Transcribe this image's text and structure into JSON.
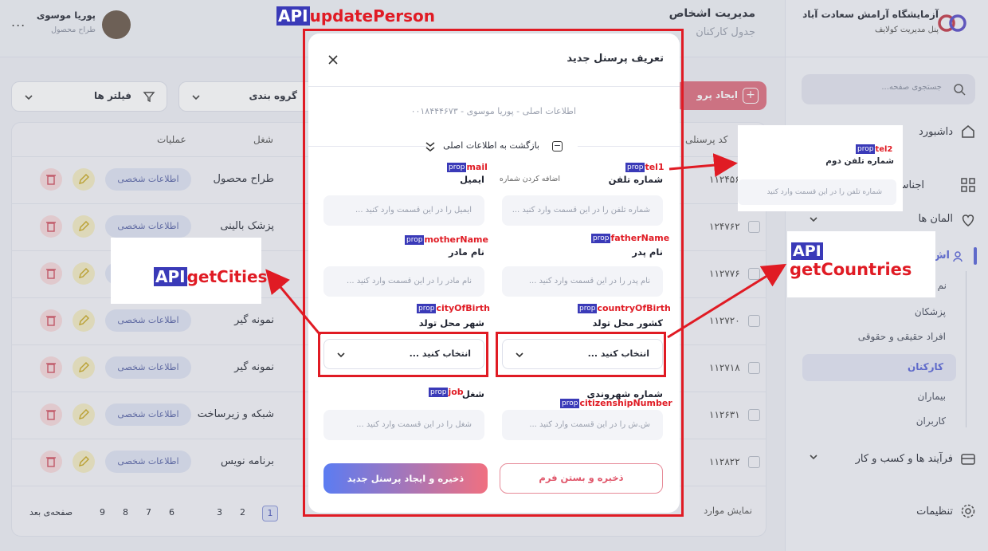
{
  "brand": {
    "title": "آزمایشگاه آرامش سعادت آباد",
    "subtitle": "پنل مدیریت کولایف"
  },
  "header": {
    "title": "مدیریت اشخاص",
    "subtitle": "جدول کارکنان"
  },
  "user": {
    "name": "پوریا موسوی",
    "role": "طراح محصول",
    "more": "..."
  },
  "search": {
    "placeholder": "جستجوی صفحه..."
  },
  "sidebar": {
    "dashboard": "داشبورد",
    "items_partial": [
      "اجناس فیزی",
      "المان ها",
      "اش"
    ],
    "subitems": [
      "پزشکان",
      "افراد حقیقی و حقوقی",
      "کارکنان",
      "بیماران",
      "کاربران"
    ],
    "sub_partial": "نم",
    "processes": "فرآیند ها و کسب و کار",
    "settings": "تنظیمات"
  },
  "toolbar": {
    "create_partial": "ایجاد پرو",
    "group": "گروه بندی",
    "filters": "فیلتر ها"
  },
  "table": {
    "headers": {
      "code": "کد پرسنلی",
      "job": "شغل",
      "ops": "عملیات"
    },
    "chip": "اطلاعات شخصی",
    "rows": [
      {
        "code": "۱۱۲۴۵۶",
        "job": "طراح محصول"
      },
      {
        "code": "۱۲۴۷۶۲",
        "job": "پزشک بالینی"
      },
      {
        "code": "۱۱۲۷۷۶",
        "job": ""
      },
      {
        "code": "۱۱۲۷۲۰",
        "job": "نمونه گیر"
      },
      {
        "code": "۱۱۲۷۱۸",
        "job": "نمونه گیر"
      },
      {
        "code": "۱۱۲۶۳۱",
        "job": "شبکه و زیرساخت"
      },
      {
        "code": "۱۱۲۸۲۲",
        "job": "برنامه نویس"
      }
    ]
  },
  "pagination": {
    "pages": [
      "1",
      "2",
      "3",
      "6",
      "7",
      "8",
      "9"
    ],
    "next": "صفحه‌ی بعد",
    "showing": "نمایش موارد"
  },
  "modal": {
    "title": "تعریف پرسنل جدید",
    "breadcrumb": "اطلاعات اصلی - پوریا موسوی - ۰۰۱۸۴۴۴۶۷۳",
    "back": "بازگشت به اطلاعات اصلی",
    "phone_label": "شماره تلفن",
    "phone_placeholder": "شماره تلفن را در این قسمت وارد کنید ...",
    "add_phone": "اضافه کردن شماره",
    "email_label": "ایمیل",
    "email_placeholder": "ایمیل را در این قسمت وارد کنید ...",
    "father_label": "نام پدر",
    "father_placeholder": "نام پدر را در این قسمت وارد کنید ...",
    "mother_label": "نام مادر",
    "mother_placeholder": "نام مادر را در این قسمت وارد کنید ...",
    "country_label": "کشور محل تولد",
    "city_label": "شهر محل تولد",
    "select_placeholder": "انتخاب کنید ...",
    "citizen_label": "شماره شهروندی",
    "citizen_placeholder": "ش.ش را در این قسمت وارد کنید ...",
    "job_label": "شغل",
    "job_placeholder": "شغل را در این قسمت وارد کنید ...",
    "save_close": "ذخیره و بستن فرم",
    "save_new": "ذخیره و ایجاد پرسنل جدید"
  },
  "annotations": {
    "api_tag": "API",
    "prop_tag": "prop",
    "update": "updatePerson",
    "cities": "getCities",
    "countries": "getCountries",
    "tel1": "tel1",
    "tel2": "tel2",
    "mail": "mail",
    "father": "fatherName",
    "mother": "motherName",
    "country": "countryOfBirth",
    "city": "cityOfBirth",
    "citizen": "citizenshipNumber",
    "job": "job",
    "tel2_label": "شماره تلفن دوم",
    "tel2_placeholder": "شماره تلفن را در این قسمت وارد کنید"
  },
  "colors": {
    "accent": "#e01b24",
    "tag": "#3a3ab8",
    "primary_grad_start": "#5b7cf2",
    "primary_grad_end": "#f07080"
  }
}
